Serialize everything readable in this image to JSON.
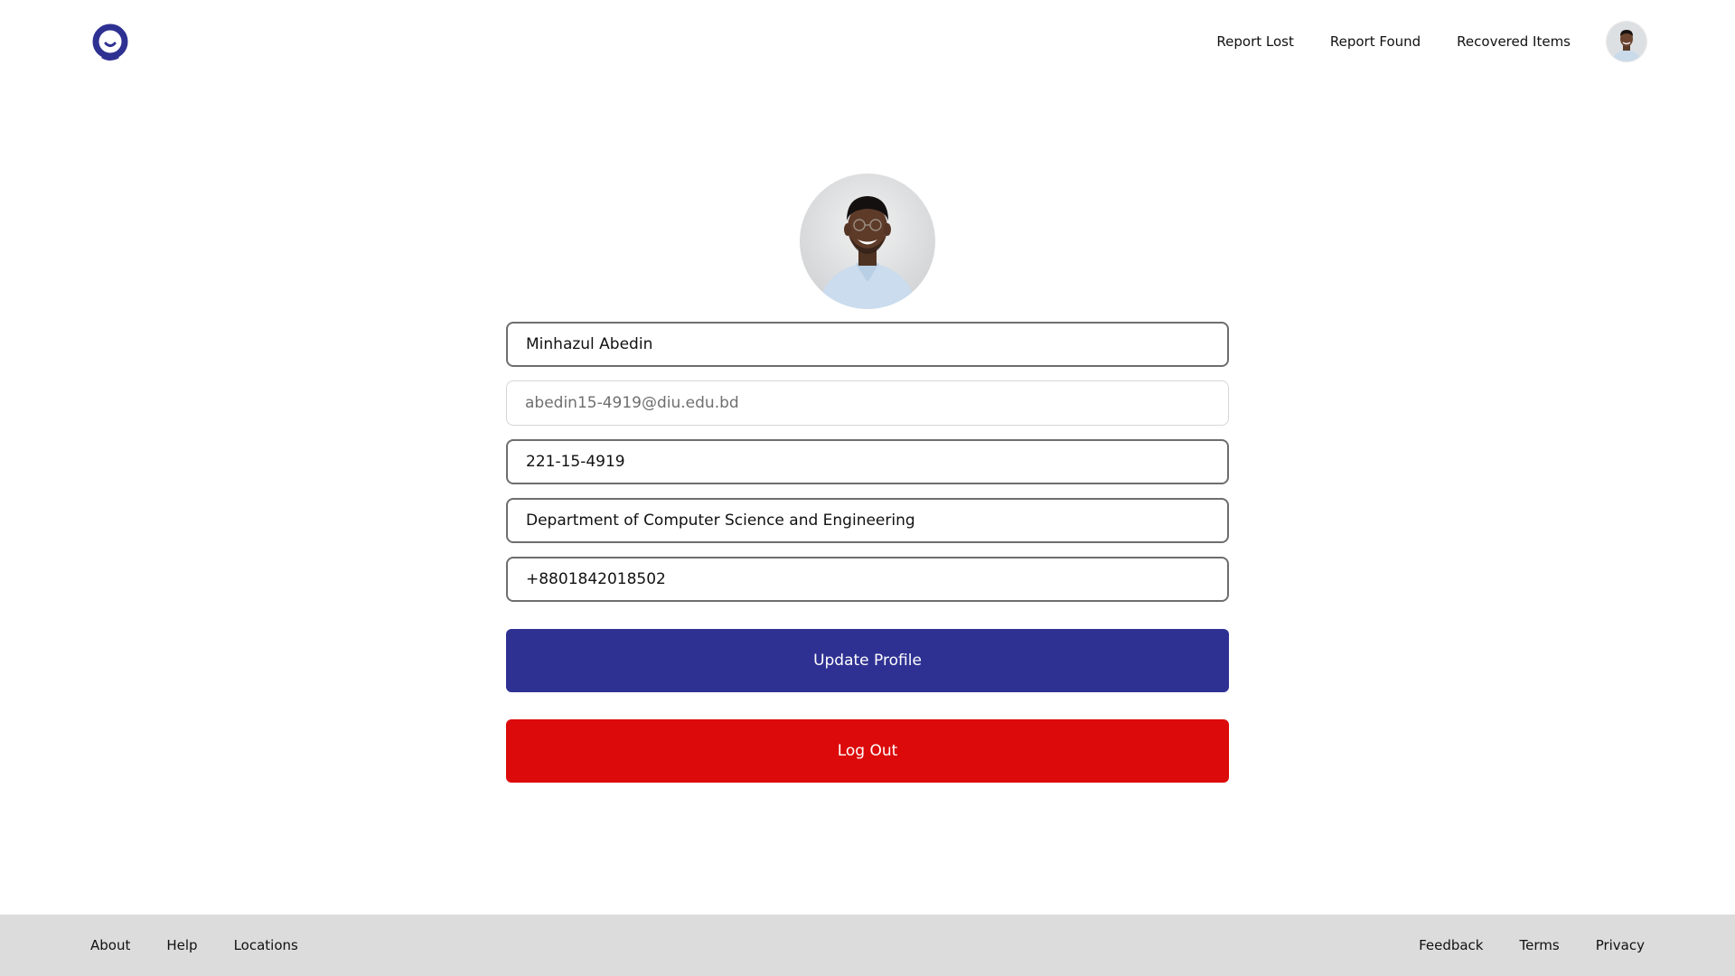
{
  "header": {
    "logo": "lost-found-logo",
    "nav": {
      "report_lost": "Report Lost",
      "report_found": "Report Found",
      "recovered_items": "Recovered Items"
    }
  },
  "profile": {
    "name": "Minhazul Abedin",
    "email": "abedin15-4919@diu.edu.bd",
    "student_id": "221-15-4919",
    "department": "Department of Computer Science and Engineering",
    "phone": "+8801842018502"
  },
  "actions": {
    "update_label": "Update Profile",
    "logout_label": "Log Out"
  },
  "footer": {
    "left": [
      "About",
      "Help",
      "Locations"
    ],
    "right": [
      "Feedback",
      "Terms",
      "Privacy"
    ]
  },
  "colors": {
    "primary": "#2e3192",
    "danger": "#dc0a0a",
    "footer_bg": "#dcdcdc"
  }
}
